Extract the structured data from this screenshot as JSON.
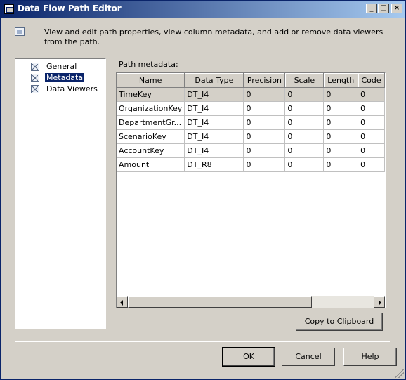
{
  "window": {
    "title": "Data Flow Path Editor",
    "controls": {
      "minimize": "_",
      "maximize": "□",
      "close": "×"
    }
  },
  "description": "View and edit path properties, view column metadata, and add or remove data viewers from the path.",
  "nav": {
    "items": [
      {
        "label": "General",
        "icon": "page-icon",
        "selected": false
      },
      {
        "label": "Metadata",
        "icon": "page-icon",
        "selected": true
      },
      {
        "label": "Data Viewers",
        "icon": "page-icon",
        "selected": false
      }
    ]
  },
  "metadata": {
    "label": "Path metadata:",
    "columns": [
      "Name",
      "Data Type",
      "Precision",
      "Scale",
      "Length",
      "Code"
    ],
    "rows": [
      [
        "TimeKey",
        "DT_I4",
        "0",
        "0",
        "0",
        "0"
      ],
      [
        "OrganizationKey",
        "DT_I4",
        "0",
        "0",
        "0",
        "0"
      ],
      [
        "DepartmentGr...",
        "DT_I4",
        "0",
        "0",
        "0",
        "0"
      ],
      [
        "ScenarioKey",
        "DT_I4",
        "0",
        "0",
        "0",
        "0"
      ],
      [
        "AccountKey",
        "DT_I4",
        "0",
        "0",
        "0",
        "0"
      ],
      [
        "Amount",
        "DT_R8",
        "0",
        "0",
        "0",
        "0"
      ]
    ],
    "selected_row": 0
  },
  "buttons": {
    "copy": "Copy to Clipboard",
    "ok": "OK",
    "cancel": "Cancel",
    "help": "Help"
  },
  "colors": {
    "titlebar_start": "#0a246a",
    "titlebar_end": "#a6caf0",
    "face": "#d4d0c8",
    "selection": "#0a246a"
  }
}
